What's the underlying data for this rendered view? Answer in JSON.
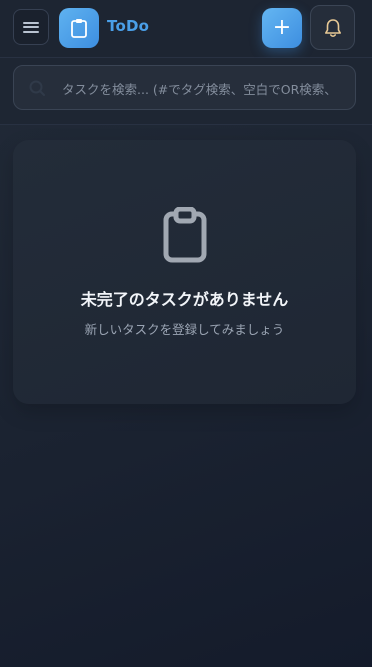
{
  "header": {
    "title": "ToDo",
    "add_label": "+"
  },
  "search": {
    "placeholder": "タスクを検索... (#でタグ検索、空白でOR検索、"
  },
  "empty_state": {
    "title": "未完了のタスクがありません",
    "subtitle": "新しいタスクを登録してみましょう"
  },
  "colors": {
    "accent": "#4a9fe8",
    "background": "#1b2331",
    "bell": "#e8c995"
  },
  "icons": [
    "menu-icon",
    "clipboard-icon",
    "plus-icon",
    "bell-icon",
    "search-icon",
    "clipboard-icon"
  ]
}
